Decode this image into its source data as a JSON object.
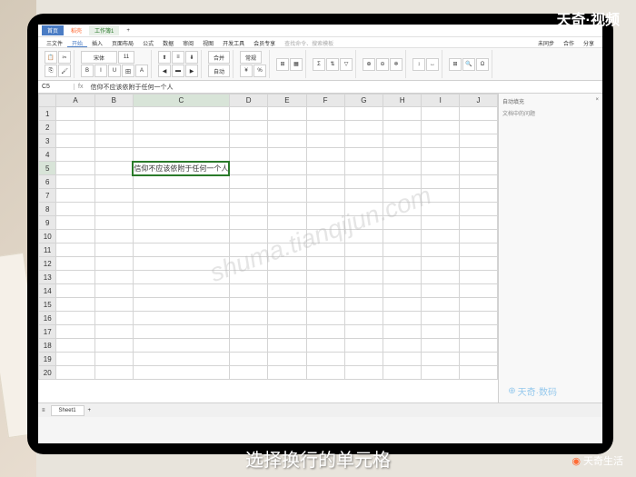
{
  "brand": {
    "top_right": "天奇·视频",
    "bottom_right": "天奇生活",
    "badge": "天奇·数码"
  },
  "subtitle": "选择换行的单元格",
  "watermark": "shuma.tianqijun.com",
  "titlebar": {
    "home": "首页",
    "start": "稻壳",
    "sheet": "工作簿1"
  },
  "ribbon_tabs": [
    "三文件",
    "开始",
    "插入",
    "页面布局",
    "公式",
    "数据",
    "审阅",
    "视图",
    "开发工具",
    "会员专享",
    "查找命令、搜索模板"
  ],
  "ribbon_right": [
    "未同步",
    "合作",
    "分享"
  ],
  "formula": {
    "cell_ref": "C5",
    "fx_label": "fx",
    "content": "信仰不应该依附于任何一个人"
  },
  "columns": [
    "A",
    "B",
    "C",
    "D",
    "E",
    "F",
    "G",
    "H",
    "I",
    "J"
  ],
  "rows": [
    1,
    2,
    3,
    4,
    5,
    6,
    7,
    8,
    9,
    10,
    11,
    12,
    13,
    14,
    15,
    16,
    17,
    18,
    19,
    20
  ],
  "active_cell": {
    "row": 5,
    "col": "C",
    "value": "信仰不应该依附于任何一个人"
  },
  "side_panel": {
    "title": "自动填充",
    "close": "×",
    "sub": "文档中的问题"
  },
  "sheet_tab": "Sheet1"
}
